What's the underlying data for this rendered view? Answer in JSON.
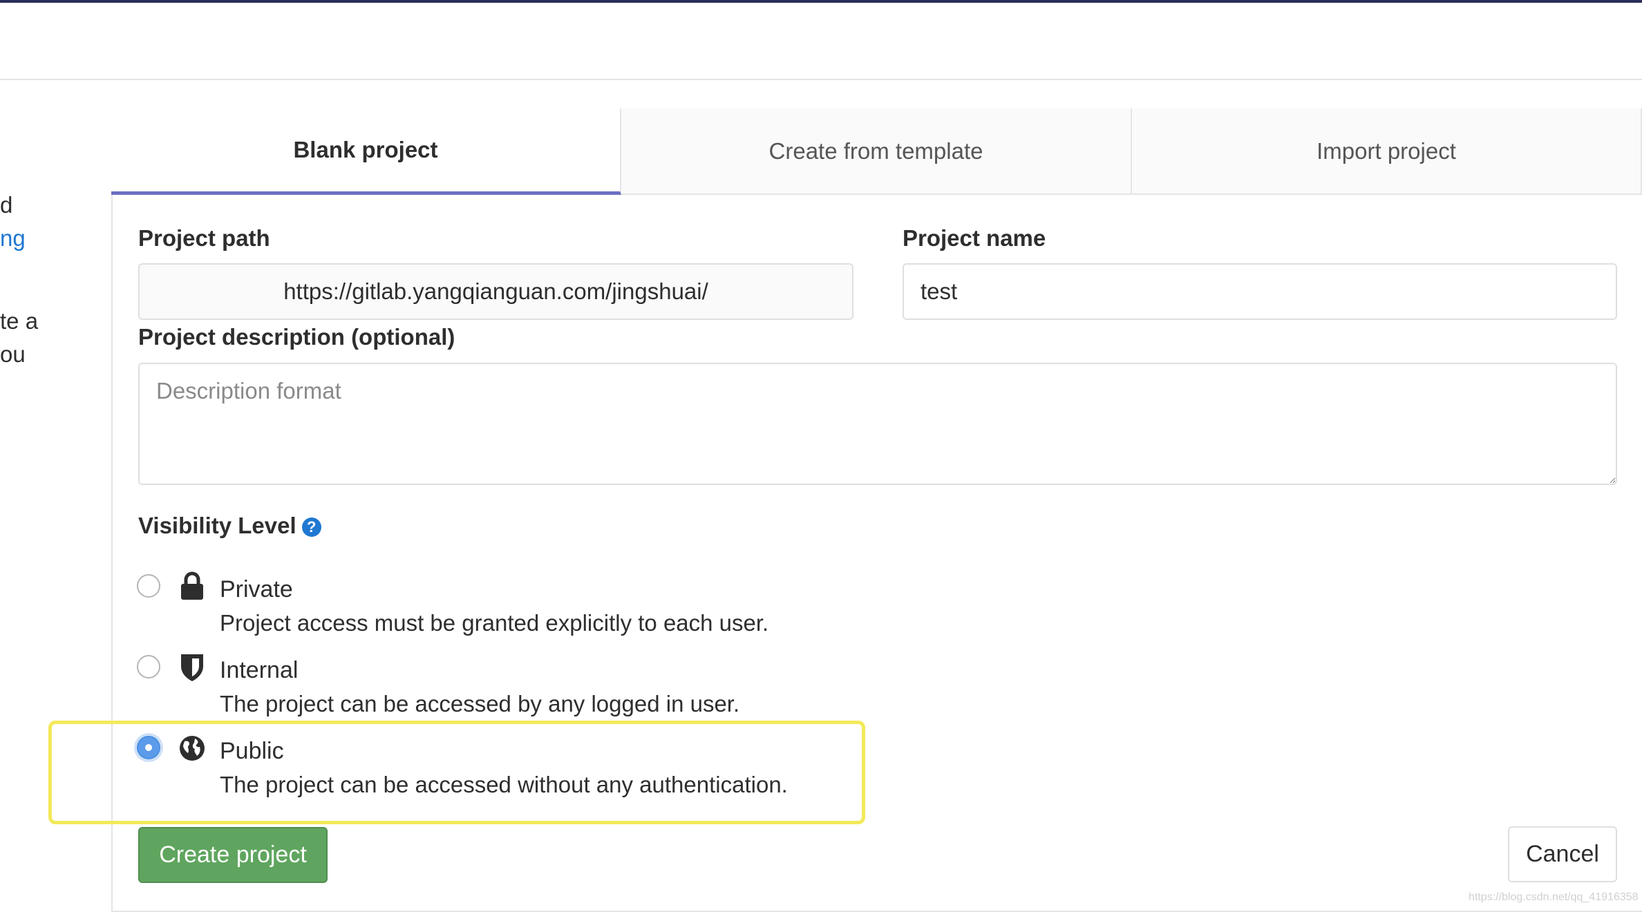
{
  "left_fragments": [
    "d",
    "ng",
    "te a",
    "ou"
  ],
  "tabs": [
    {
      "label": "Blank project",
      "active": true
    },
    {
      "label": "Create from template",
      "active": false
    },
    {
      "label": "Import project",
      "active": false
    }
  ],
  "form": {
    "path_label": "Project path",
    "path_value": "https://gitlab.yangqianguan.com/jingshuai/",
    "name_label": "Project name",
    "name_value": "test",
    "description_label": "Project description (optional)",
    "description_placeholder": "Description format",
    "visibility_label": "Visibility Level",
    "help_glyph": "?",
    "visibility_options": [
      {
        "title": "Private",
        "description": "Project access must be granted explicitly to each user.",
        "icon": "lock-icon",
        "checked": false
      },
      {
        "title": "Internal",
        "description": "The project can be accessed by any logged in user.",
        "icon": "shield-icon",
        "checked": false
      },
      {
        "title": "Public",
        "description": "The project can be accessed without any authentication.",
        "icon": "globe-icon",
        "checked": true
      }
    ]
  },
  "actions": {
    "create_label": "Create project",
    "cancel_label": "Cancel"
  },
  "watermark": "https://blog.csdn.net/qq_41916358",
  "colors": {
    "accent": "#6b6fc4",
    "create_button": "#5fa55f",
    "highlight": "#f3e95a",
    "link": "#1f78d1"
  }
}
